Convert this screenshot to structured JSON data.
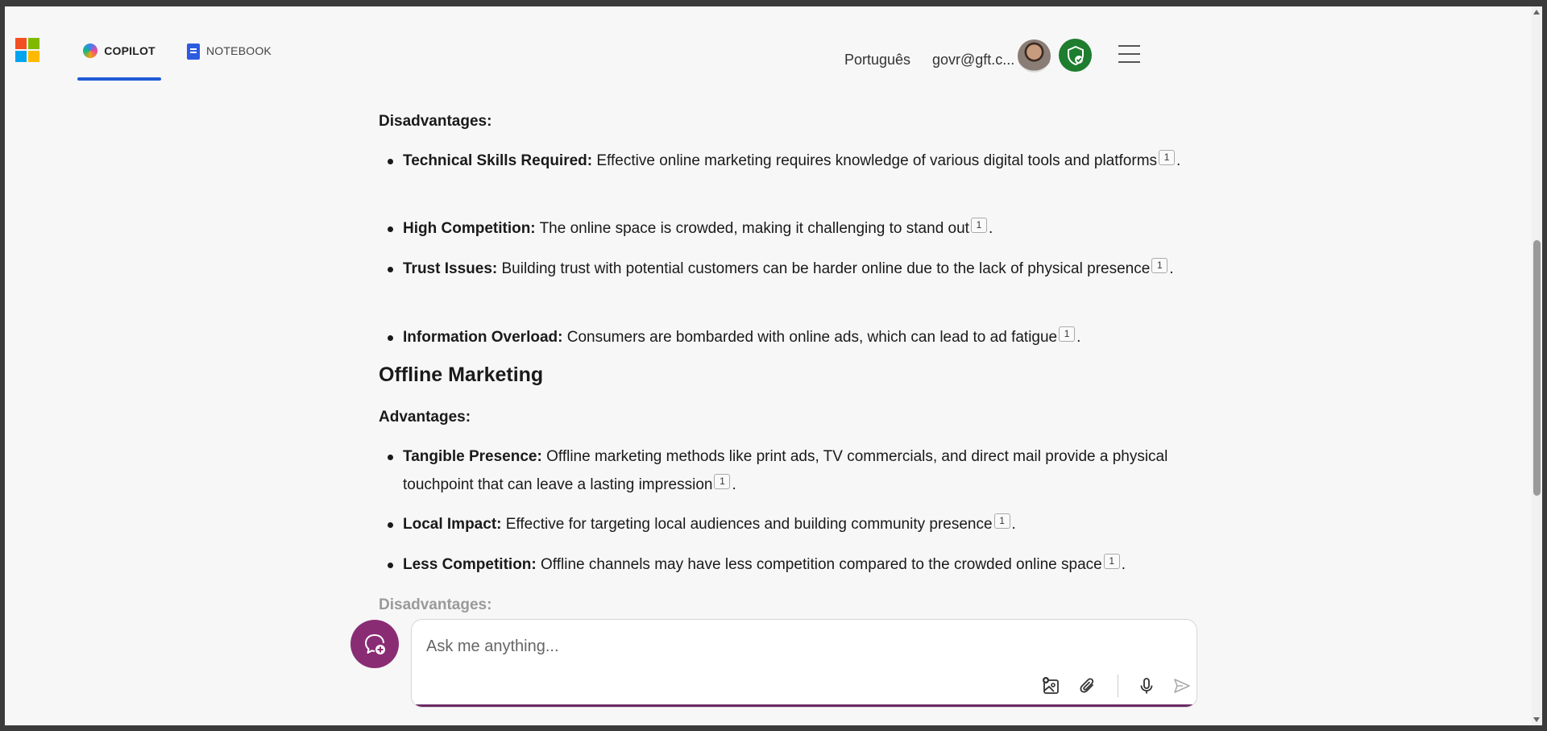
{
  "header": {
    "tabs": [
      {
        "label": "COPILOT",
        "icon": "copilot-icon",
        "active": true
      },
      {
        "label": "NOTEBOOK",
        "icon": "notebook-icon",
        "active": false
      }
    ],
    "language": "Português",
    "account": "govr@gft.c...",
    "avatar_icon": "user-avatar",
    "shield_icon": "shield-check-icon",
    "menu_icon": "hamburger-menu-icon"
  },
  "content": {
    "online_disadvantages_label": "Disadvantages:",
    "online_disadvantages": [
      {
        "title": "Technical Skills Required:",
        "text": " Effective online marketing requires knowledge of various digital tools and platforms",
        "cite": "1"
      },
      {
        "title": "High Competition:",
        "text": " The online space is crowded, making it challenging to stand out",
        "cite": "1"
      },
      {
        "title": "Trust Issues:",
        "text": " Building trust with potential customers can be harder online due to the lack of physical presence",
        "cite": "1"
      },
      {
        "title": "Information Overload:",
        "text": " Consumers are bombarded with online ads, which can lead to ad fatigue",
        "cite": "1"
      }
    ],
    "offline_heading": "Offline Marketing",
    "offline_advantages_label": "Advantages:",
    "offline_advantages": [
      {
        "title": "Tangible Presence:",
        "text": " Offline marketing methods like print ads, TV commercials, and direct mail provide a physical touchpoint that can leave a lasting impression",
        "cite": "1"
      },
      {
        "title": "Local Impact:",
        "text": " Effective for targeting local audiences and building community presence",
        "cite": "1"
      },
      {
        "title": "Less Competition:",
        "text": " Offline channels may have less competition compared to the crowded online space",
        "cite": "1"
      }
    ],
    "offline_disadvantages_label": "Disadvantages:"
  },
  "composer": {
    "placeholder": "Ask me anything...",
    "new_topic_icon": "new-topic-icon",
    "tools": [
      "add-image-icon",
      "attach-icon",
      "microphone-icon",
      "send-icon"
    ]
  },
  "colors": {
    "accent_blue": "#1f5bd6",
    "brand_purple": "#8a2c74",
    "shield_green": "#1e7d2e"
  }
}
